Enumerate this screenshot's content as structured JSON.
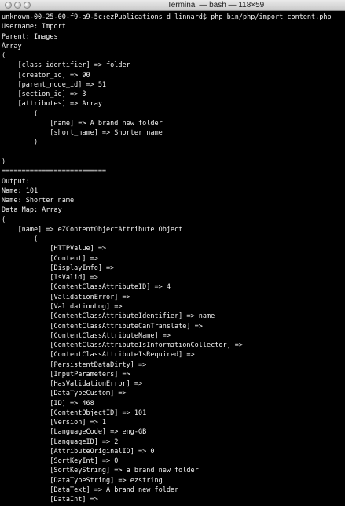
{
  "window": {
    "title": "Terminal — bash — 118×59"
  },
  "terminal": {
    "lines": [
      "unknown-00-25-00-f9-a9-5c:ezPublications d_linnard$ php bin/php/import_content.php",
      "Username: Import",
      "Parent: Images",
      "Array",
      "(",
      "    [class_identifier] => folder",
      "    [creator_id] => 90",
      "    [parent_node_id] => 51",
      "    [section_id] => 3",
      "    [attributes] => Array",
      "        (",
      "            [name] => A brand new folder",
      "            [short_name] => Shorter name",
      "        )",
      "",
      ")",
      "==========================",
      "Output:",
      "Name: 101",
      "Name: Shorter name",
      "Data Map: Array",
      "(",
      "    [name] => eZContentObjectAttribute Object",
      "        (",
      "            [HTTPValue] =>",
      "            [Content] =>",
      "            [DisplayInfo] =>",
      "            [IsValid] =>",
      "            [ContentClassAttributeID] => 4",
      "            [ValidationError] =>",
      "            [ValidationLog] =>",
      "            [ContentClassAttributeIdentifier] => name",
      "            [ContentClassAttributeCanTranslate] =>",
      "            [ContentClassAttributeName] =>",
      "            [ContentClassAttributeIsInformationCollector] =>",
      "            [ContentClassAttributeIsRequired] =>",
      "            [PersistentDataDirty] =>",
      "            [InputParameters] =>",
      "            [HasValidationError] =>",
      "            [DataTypeCustom] =>",
      "            [ID] => 468",
      "            [ContentObjectID] => 101",
      "            [Version] => 1",
      "            [LanguageCode] => eng-GB",
      "            [LanguageID] => 2",
      "            [AttributeOriginalID] => 0",
      "            [SortKeyInt] => 0",
      "            [SortKeyString] => a brand new folder",
      "            [DataTypeString] => ezstring",
      "            [DataText] => A brand new folder",
      "            [DataInt] =>"
    ]
  }
}
